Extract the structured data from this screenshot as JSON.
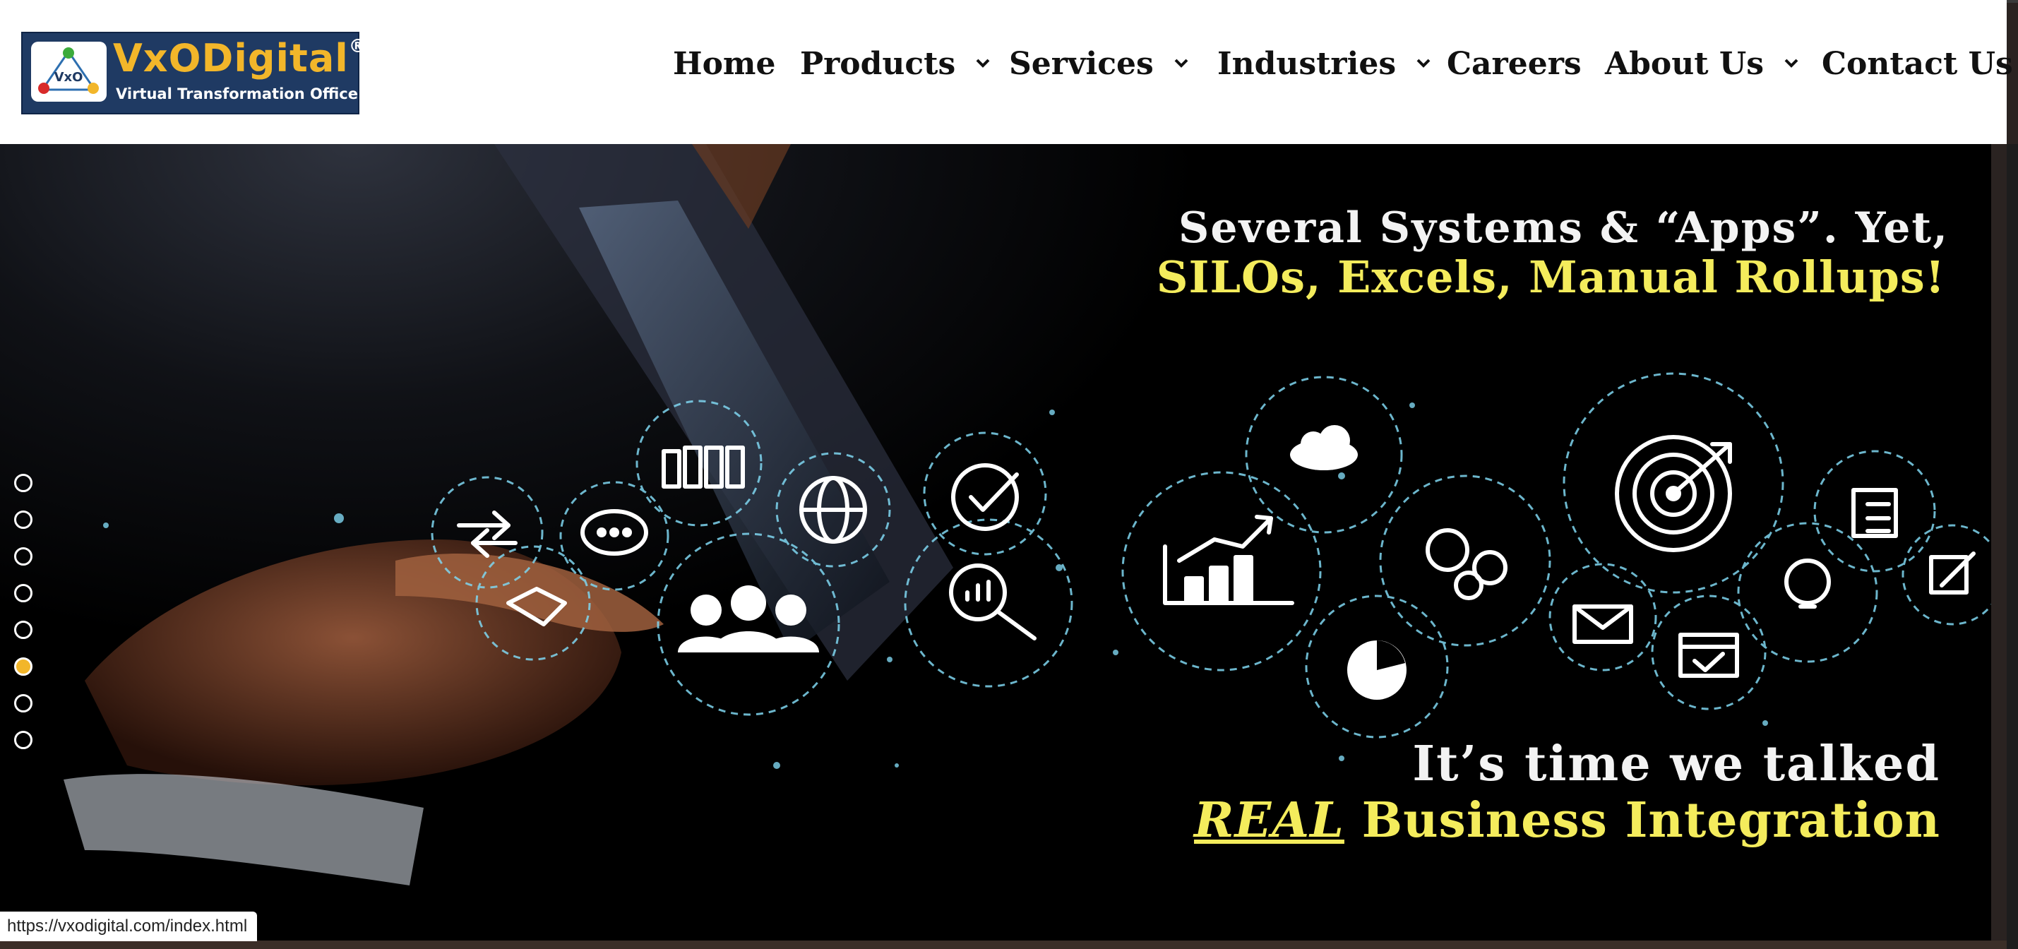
{
  "brand": {
    "name": "VxODigital",
    "registered_mark": "®",
    "tagline": "Virtual Transformation Office",
    "mark_text": "VxO"
  },
  "nav": {
    "items": [
      {
        "label": "Home",
        "dropdown": false
      },
      {
        "label": "Products",
        "dropdown": true
      },
      {
        "label": "Services",
        "dropdown": true
      },
      {
        "label": "Industries",
        "dropdown": true
      },
      {
        "label": "Careers",
        "dropdown": false
      },
      {
        "label": "About Us",
        "dropdown": true
      },
      {
        "label": "Contact Us",
        "dropdown": false
      }
    ]
  },
  "hero": {
    "line1": "Several Systems  & “Apps”. Yet,",
    "line2": "SILOs, Excels, Manual Rollups!",
    "line3": "It’s time we talked",
    "line4_emphasis": "REAL",
    "line4_rest": "Business Integration"
  },
  "carousel": {
    "slide_count": 8,
    "active_index": 5
  },
  "status": {
    "url": "https://vxodigital.com/index.html"
  },
  "colors": {
    "brand_navy": "#1f3a63",
    "brand_gold": "#f2b62a",
    "hero_yellow": "#f4ec5c",
    "hero_white": "#f3f3f3",
    "icon_glow": "#7fd6f0"
  },
  "icons": [
    "swap-arrows-icon",
    "chat-bubble-icon",
    "handshake-icon",
    "binders-icon",
    "team-icon",
    "globe-icon",
    "checkmark-icon",
    "analytics-search-icon",
    "growth-chart-icon",
    "cloud-sync-icon",
    "gears-icon",
    "pie-chart-icon",
    "target-icon",
    "checklist-icon",
    "lightbulb-icon",
    "envelope-icon",
    "calendar-check-icon",
    "edit-icon"
  ]
}
